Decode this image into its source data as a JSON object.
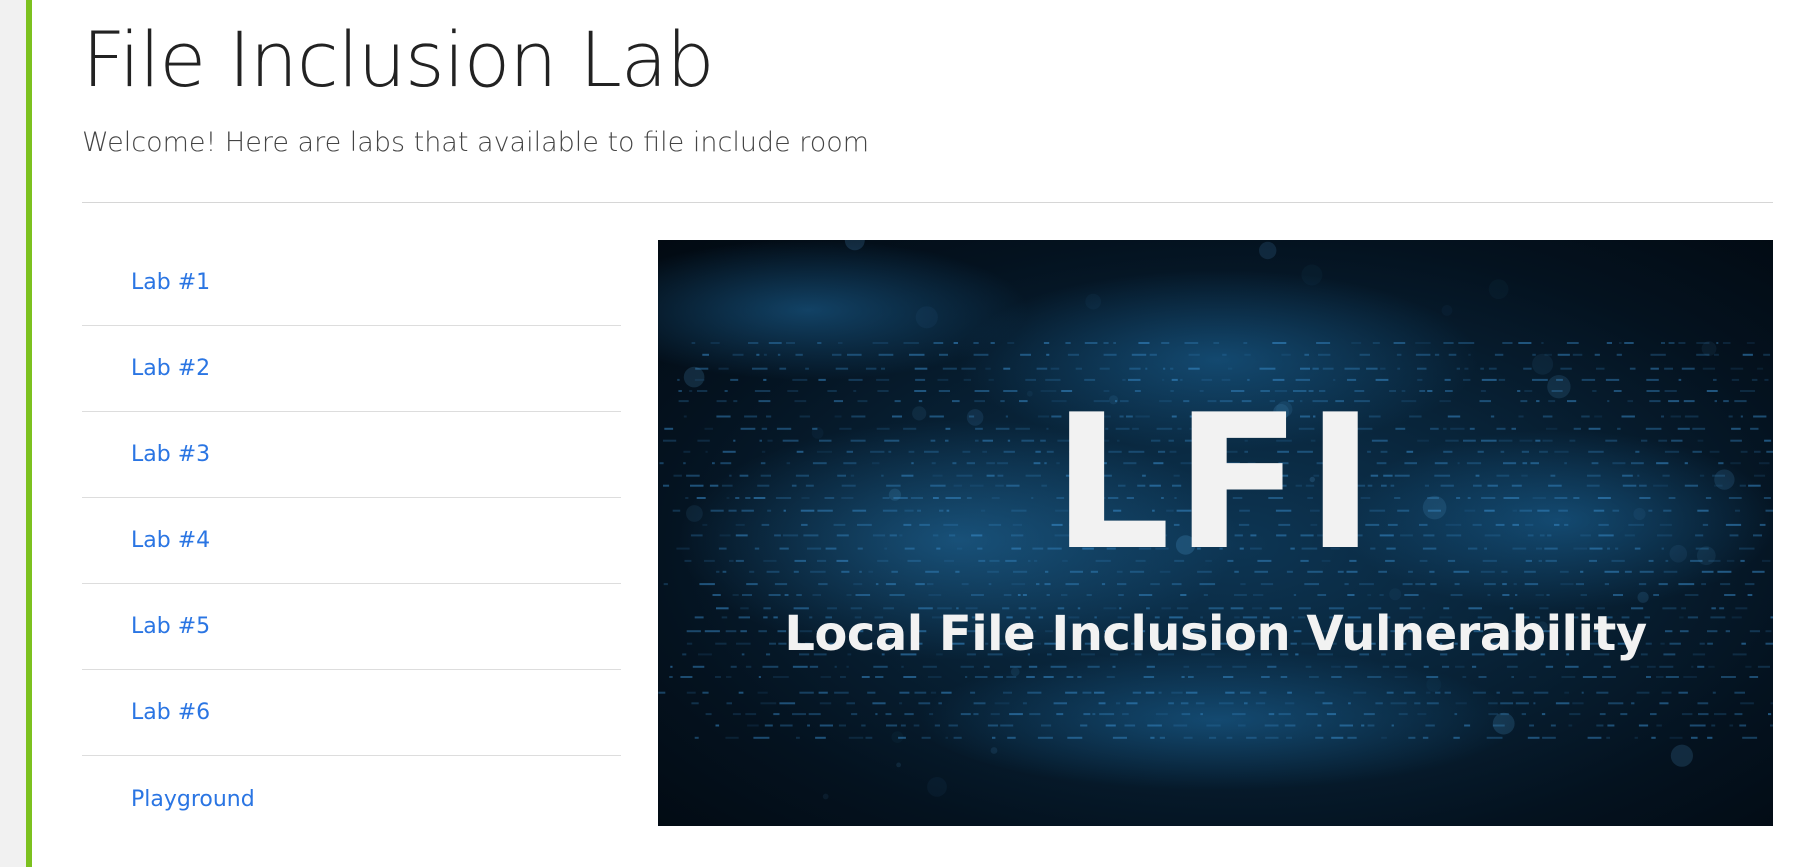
{
  "header": {
    "title": "File Inclusion Lab",
    "subtitle": "Welcome! Here are labs that available to file include room"
  },
  "labs": {
    "items": [
      {
        "label": "Lab #1"
      },
      {
        "label": "Lab #2"
      },
      {
        "label": "Lab #3"
      },
      {
        "label": "Lab #4"
      },
      {
        "label": "Lab #5"
      },
      {
        "label": "Lab #6"
      },
      {
        "label": "Playground"
      }
    ]
  },
  "banner": {
    "big_text": "LFI",
    "caption": "Local File Inclusion Vulnerability"
  },
  "colors": {
    "accent": "#7cc11f",
    "link": "#2a75e3",
    "title": "#222222",
    "banner_bg": "#04121f"
  }
}
